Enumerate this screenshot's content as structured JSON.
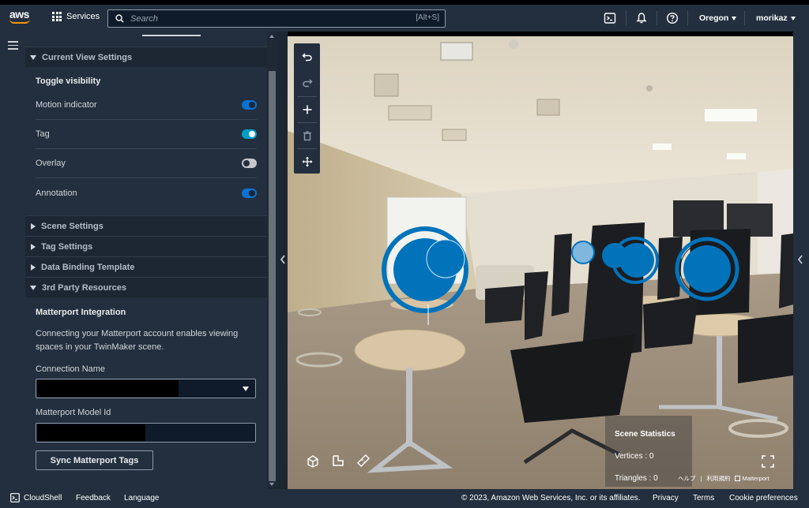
{
  "topnav": {
    "logo_text": "aws",
    "services_label": "Services",
    "search_placeholder": "Search",
    "search_shortcut": "[Alt+S]",
    "region": "Oregon",
    "user": "morikaz",
    "icons": [
      "cloudshell-icon",
      "bell-icon",
      "help-icon"
    ]
  },
  "panel": {
    "current_view_settings": "Current View Settings",
    "toggle_visibility": "Toggle visibility",
    "toggles": [
      {
        "label": "Motion indicator",
        "on": true
      },
      {
        "label": "Tag",
        "on": true
      },
      {
        "label": "Overlay",
        "on": false
      },
      {
        "label": "Annotation",
        "on": true
      }
    ],
    "scene_settings": "Scene Settings",
    "tag_settings": "Tag Settings",
    "data_binding_template": "Data Binding Template",
    "third_party_resources": "3rd Party Resources",
    "matterport_integration": "Matterport Integration",
    "matterport_desc": "Connecting your Matterport account enables viewing spaces in your TwinMaker scene.",
    "connection_name_label": "Connection Name",
    "model_id_label": "Matterport Model Id",
    "sync_button": "Sync Matterport Tags"
  },
  "viewer": {
    "stats_title": "Scene Statistics",
    "vertices": "Vertices : 0",
    "triangles": "Triangles : 0",
    "help_link": "ヘルプ",
    "terms_link": "利用規約",
    "matterport_brand": "Matterport",
    "toolbar_icons": [
      "undo-icon",
      "redo-icon",
      "add-icon",
      "delete-icon",
      "move-icon"
    ]
  },
  "footer": {
    "cloudshell": "CloudShell",
    "feedback": "Feedback",
    "language": "Language",
    "copyright": "© 2023, Amazon Web Services, Inc. or its affiliates.",
    "privacy": "Privacy",
    "terms": "Terms",
    "cookie": "Cookie preferences"
  },
  "colors": {
    "nav_bg": "#232f3e",
    "toggle_on": "#0972d3",
    "tag_blue": "#0073bb",
    "accent_orange": "#ff9900"
  }
}
